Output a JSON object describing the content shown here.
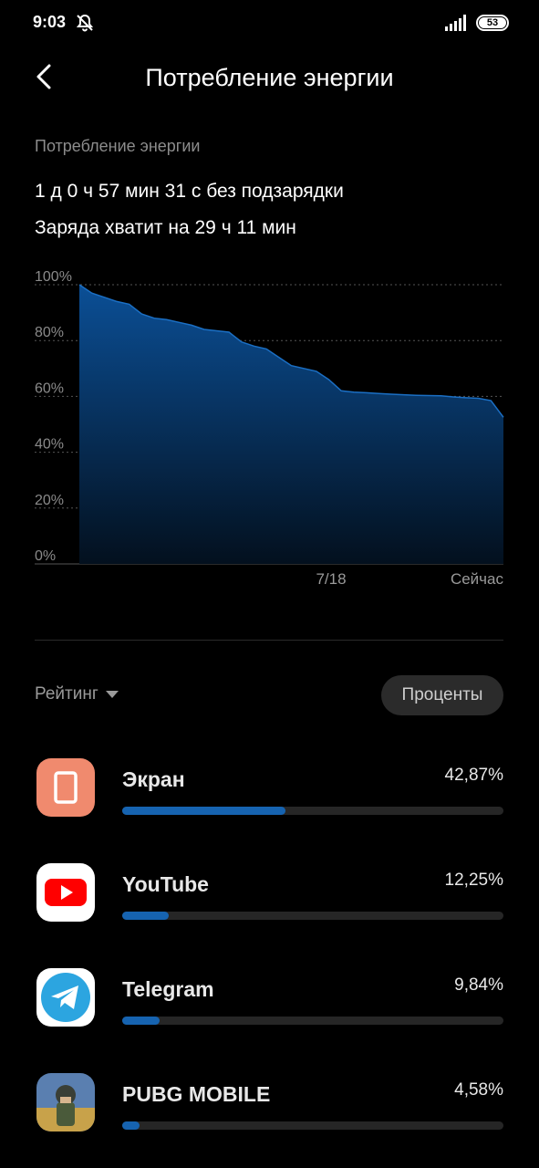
{
  "status_bar": {
    "time": "9:03",
    "battery": "53"
  },
  "header": {
    "title": "Потребление энергии"
  },
  "summary": {
    "section_label": "Потребление энергии",
    "line1": "1 д 0 ч 57 мин 31 с без подзарядки",
    "line2": "Заряда хватит на 29 ч 11 мин"
  },
  "chart_data": {
    "type": "area",
    "title": "",
    "xlabel": "",
    "ylabel": "",
    "ylim": [
      0,
      100
    ],
    "y_ticks": [
      "100%",
      "80%",
      "60%",
      "40%",
      "20%",
      "0%"
    ],
    "x_tick_labels": [
      "7/18",
      "Сейчас"
    ],
    "grid": true,
    "series": [
      {
        "values": [
          100,
          97,
          95.5,
          94,
          93,
          89.5,
          88,
          87.5,
          86.5,
          85.5,
          84,
          83.5,
          83,
          79.5,
          78,
          77,
          74,
          71,
          70,
          69,
          66,
          62,
          61.5,
          61.3,
          61,
          60.8,
          60.6,
          60.4,
          60.3,
          60.2,
          59.8,
          59.5,
          59.3,
          58.5,
          52.5
        ]
      }
    ]
  },
  "controls": {
    "rating_label": "Рейтинг",
    "percent_button": "Проценты"
  },
  "apps": [
    {
      "name": "Экран",
      "percent": "42,87%",
      "share": 42.87,
      "icon": "screen-icon",
      "color": "#f08a6e"
    },
    {
      "name": "YouTube",
      "percent": "12,25%",
      "share": 12.25,
      "icon": "youtube-icon",
      "color": "#ff0000"
    },
    {
      "name": "Telegram",
      "percent": "9,84%",
      "share": 9.84,
      "icon": "telegram-icon",
      "color": "#2ca5e0"
    },
    {
      "name": "PUBG MOBILE",
      "percent": "4,58%",
      "share": 4.58,
      "icon": "pubg-icon",
      "color": "#c8a24a"
    }
  ],
  "colors": {
    "accent": "#1663b0",
    "background": "#000000"
  }
}
